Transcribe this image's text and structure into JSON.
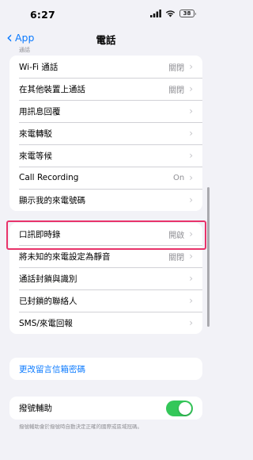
{
  "status_bar": {
    "time": "6:27",
    "battery": "38"
  },
  "nav": {
    "back_label": "App",
    "title": "電話"
  },
  "cut_header": "通話",
  "group1": [
    {
      "label": "Wi-Fi 通話",
      "value": "關閉"
    },
    {
      "label": "在其他裝置上通話",
      "value": "關閉"
    },
    {
      "label": "用訊息回覆",
      "value": ""
    },
    {
      "label": "來電轉駁",
      "value": ""
    },
    {
      "label": "來電等候",
      "value": ""
    },
    {
      "label": "Call Recording",
      "value": "On"
    },
    {
      "label": "顯示我的來電號碼",
      "value": ""
    }
  ],
  "group2": [
    {
      "label": "口訊即時錄",
      "value": "開啟"
    },
    {
      "label": "將未知的來電設定為靜音",
      "value": "關閉"
    },
    {
      "label": "通話封鎖與識別",
      "value": ""
    },
    {
      "label": "已封鎖的聯絡人",
      "value": ""
    },
    {
      "label": "SMS/來電回報",
      "value": ""
    }
  ],
  "voicemail_link": "更改留言信箱密碼",
  "dial_assist": {
    "label": "撥號輔助",
    "enabled": true
  },
  "dial_assist_note": "撥號輔助會於撥號時自動決定正確的國際或區域冠碼。",
  "colors": {
    "accent": "#0a7aff",
    "highlight": "#e8336a",
    "toggle_on": "#34c759"
  }
}
